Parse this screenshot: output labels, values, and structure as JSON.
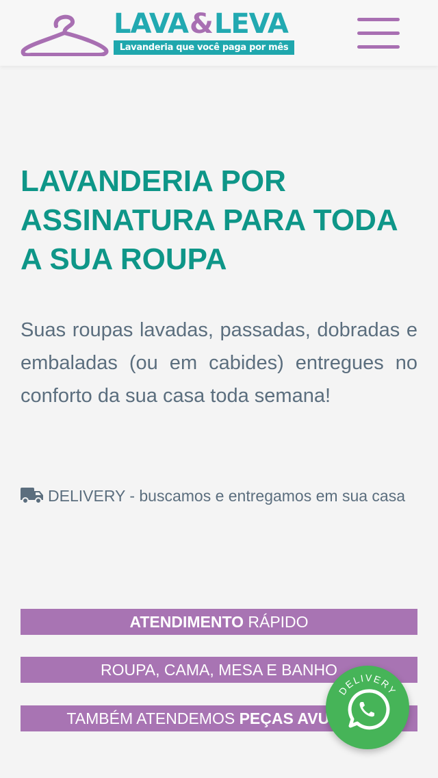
{
  "header": {
    "logo": {
      "word_left": "LAVA",
      "word_amp": "&",
      "word_right": "LEVA",
      "tagline": "Lavanderia que você paga por mês"
    },
    "menu_icon": "hamburger-menu-icon"
  },
  "hero": {
    "title": "LAVANDERIA POR ASSINATURA PARA TODA A SUA ROUPA",
    "description": "Suas roupas lavadas, passadas, dobradas e embaladas (ou em cabides) entregues no conforto da sua casa toda semana!",
    "delivery_text": "DELIVERY - buscamos e entregamos em sua casa",
    "delivery_icon": "truck-icon"
  },
  "features": [
    {
      "bold": "ATENDIMENTO",
      "text": " RÁPIDO"
    },
    {
      "text": "ROUPA, CAMA, MESA E BANHO"
    },
    {
      "text": "TAMBÉM ATENDEMOS ",
      "bold": "PEÇAS AVULSAS"
    }
  ],
  "whatsapp": {
    "label": "DELIVERY",
    "icon": "whatsapp-icon"
  },
  "colors": {
    "brand_teal": "#0e9688",
    "logo_teal": "#22a9b1",
    "purple": "#a874b3",
    "text_gray": "#5b6e7e",
    "whatsapp_green": "#46b458"
  }
}
